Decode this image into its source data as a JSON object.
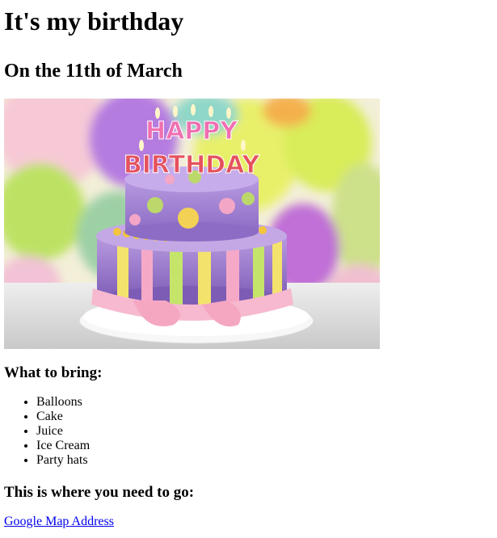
{
  "page": {
    "title": "It's my birthday",
    "subtitle": "On the 11th of March"
  },
  "image": {
    "alt": "birthday-cake",
    "cake_text_top": "HAPPY",
    "cake_text_bottom": "BIRTHDAY"
  },
  "bring": {
    "heading": "What to bring:",
    "items": [
      "Balloons",
      "Cake",
      "Juice",
      "Ice Cream",
      "Party hats"
    ]
  },
  "location": {
    "heading": "This is where you need to go:",
    "link_text": "Google Map Address"
  },
  "colors": {
    "link": "#0000ee"
  }
}
